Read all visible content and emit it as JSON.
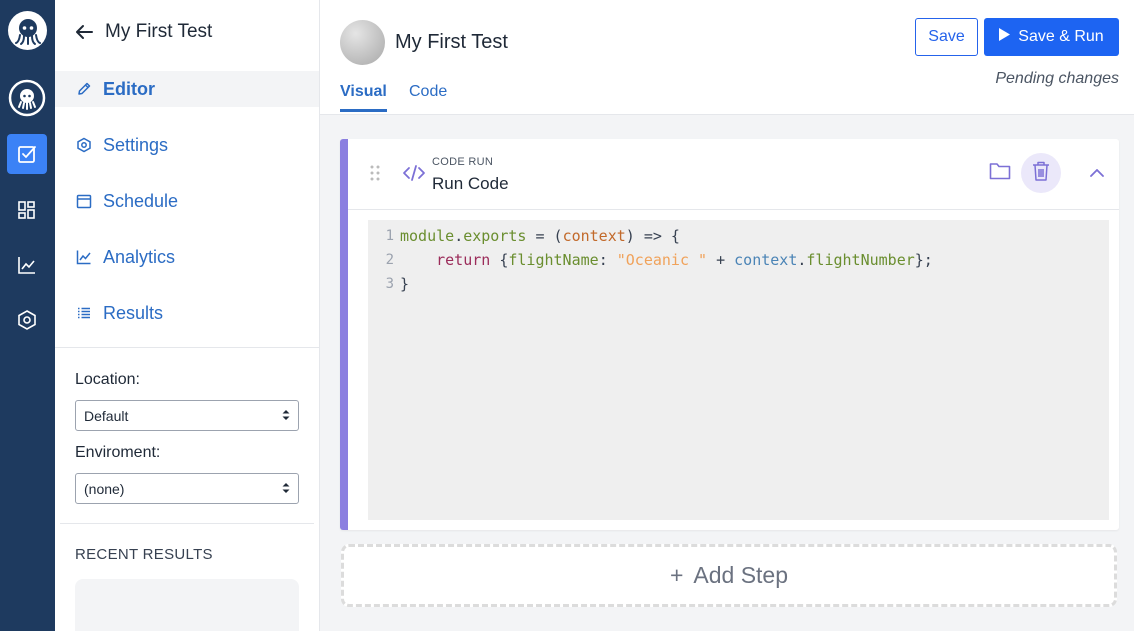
{
  "rail": {
    "icons": [
      "logo-icon",
      "octopus-avatar-icon",
      "tests-icon",
      "dashboard-icon",
      "analytics-icon",
      "settings-icon"
    ],
    "active_color": "#3b82f6",
    "bg_color": "#1e3a5f"
  },
  "sidebar": {
    "title": "My First Test",
    "items": [
      {
        "label": "Editor",
        "icon": "pencil-icon",
        "active": true
      },
      {
        "label": "Settings",
        "icon": "gear-icon",
        "active": false
      },
      {
        "label": "Schedule",
        "icon": "calendar-icon",
        "active": false
      },
      {
        "label": "Analytics",
        "icon": "chart-icon",
        "active": false
      },
      {
        "label": "Results",
        "icon": "list-icon",
        "active": false
      }
    ],
    "location_label": "Location:",
    "location_value": "Default",
    "environment_label": "Enviroment:",
    "environment_value": "(none)",
    "recent_results_label": "RECENT RESULTS"
  },
  "header": {
    "title": "My First Test",
    "tabs": [
      {
        "label": "Visual",
        "active": true
      },
      {
        "label": "Code",
        "active": false
      }
    ],
    "save_label": "Save",
    "save_run_label": "Save & Run",
    "status": "Pending changes"
  },
  "step": {
    "kind": "CODE RUN",
    "name": "Run Code",
    "accent_color": "#8b7fe0",
    "code_lines": [
      {
        "n": "1"
      },
      {
        "n": "2"
      },
      {
        "n": "3"
      }
    ],
    "tokens": {
      "l1": [
        "module",
        ".",
        "exports",
        " = (",
        "context",
        ") => {"
      ],
      "l2": [
        "    ",
        "return",
        " {",
        "flightName",
        ": ",
        "\"Oceanic \"",
        " + ",
        "context",
        ".",
        "flightNumber",
        "};"
      ],
      "l3": [
        "}"
      ]
    }
  },
  "add_step": {
    "plus": "+",
    "label": "Add Step"
  }
}
